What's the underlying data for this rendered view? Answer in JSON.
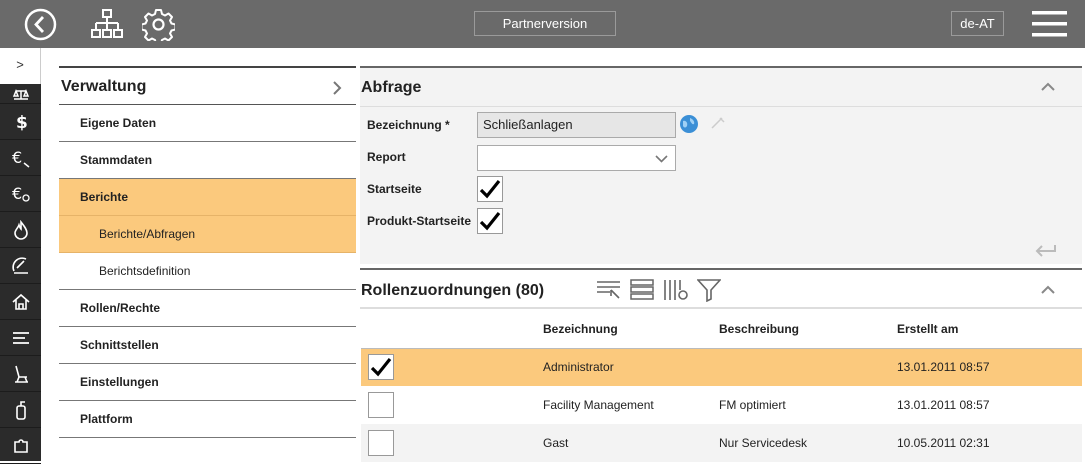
{
  "topbar": {
    "partner_label": "Partnerversion",
    "lang_label": "de-AT",
    "icons": [
      "back-icon",
      "org-tree-icon",
      "gear-icon",
      "menu-icon"
    ]
  },
  "rail": {
    "top_symbol": ">",
    "items": [
      "scale-icon",
      "dollar-icon",
      "euro-search-icon",
      "euro-magnify-icon",
      "flame-icon",
      "satellite-dish-icon",
      "house-icon",
      "list-icon",
      "seat-icon",
      "fire-extinguisher-icon",
      "puzzle-icon"
    ]
  },
  "nav": {
    "title": "Verwaltung",
    "items": [
      {
        "label": "Eigene Daten",
        "level": 1,
        "active": false
      },
      {
        "label": "Stammdaten",
        "level": 1,
        "active": false
      },
      {
        "label": "Berichte",
        "level": 1,
        "active": true
      },
      {
        "label": "Berichte/Abfragen",
        "level": 2,
        "active": true
      },
      {
        "label": "Berichtsdefinition",
        "level": 2,
        "active": false
      },
      {
        "label": "Rollen/Rechte",
        "level": 1,
        "active": false
      },
      {
        "label": "Schnittstellen",
        "level": 1,
        "active": false
      },
      {
        "label": "Einstellungen",
        "level": 1,
        "active": false
      },
      {
        "label": "Plattform",
        "level": 1,
        "active": false
      }
    ]
  },
  "abfrage": {
    "title": "Abfrage",
    "bezeichnung_label": "Bezeichnung *",
    "bezeichnung_value": "Schließanlagen",
    "report_label": "Report",
    "report_value": "",
    "startseite_label": "Startseite",
    "startseite_checked": true,
    "produkt_label": "Produkt-Startseite",
    "produkt_checked": true
  },
  "rollen": {
    "title": "Rollenzuordnungen (80)",
    "columns": [
      "",
      "Bezeichnung",
      "Beschreibung",
      "Erstellt am"
    ],
    "rows": [
      {
        "checked": true,
        "bezeichnung": "Administrator",
        "beschreibung": "",
        "erstellt": "13.01.2011 08:57"
      },
      {
        "checked": false,
        "bezeichnung": "Facility Management",
        "beschreibung": "FM optimiert",
        "erstellt": "13.01.2011 08:57"
      },
      {
        "checked": false,
        "bezeichnung": "Gast",
        "beschreibung": "Nur Servicedesk",
        "erstellt": "10.05.2011 02:31"
      }
    ]
  },
  "colors": {
    "topbar": "#6a6a6a",
    "highlight": "#fbc97d",
    "rail": "#2b2b2b"
  }
}
